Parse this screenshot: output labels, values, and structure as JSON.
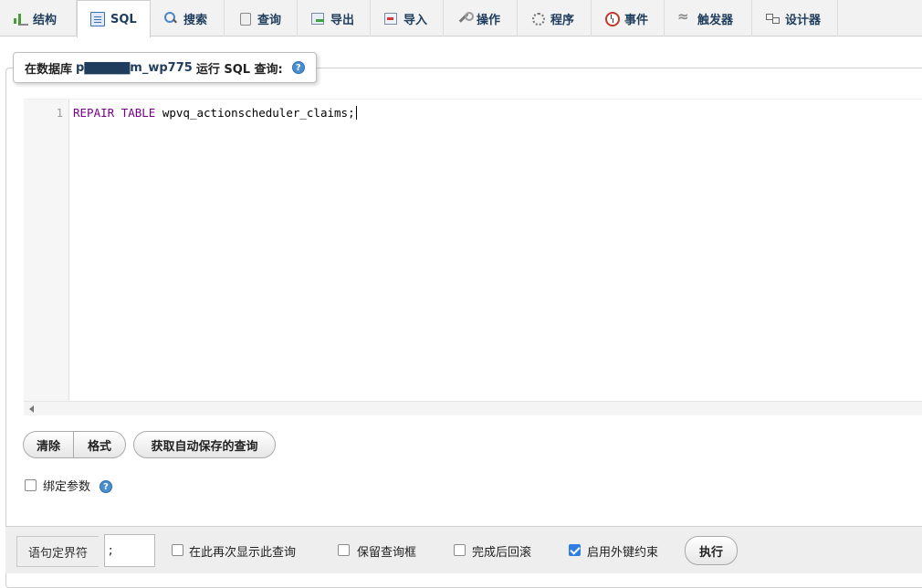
{
  "tabs": [
    {
      "label": "结构",
      "icon": "structure-icon"
    },
    {
      "label": "SQL",
      "icon": "sql-icon",
      "active": true
    },
    {
      "label": "搜索",
      "icon": "search-icon"
    },
    {
      "label": "查询",
      "icon": "query-icon"
    },
    {
      "label": "导出",
      "icon": "export-icon"
    },
    {
      "label": "导入",
      "icon": "import-icon"
    },
    {
      "label": "操作",
      "icon": "wrench-icon"
    },
    {
      "label": "程序",
      "icon": "routines-icon"
    },
    {
      "label": "事件",
      "icon": "clock-icon"
    },
    {
      "label": "触发器",
      "icon": "trigger-icon"
    },
    {
      "label": "设计器",
      "icon": "designer-icon"
    }
  ],
  "query_panel": {
    "legend_prefix": "在数据库",
    "db_name": "p▇▇▇▇▇m_wp775",
    "legend_suffix": "运行 SQL 查询:",
    "help_icon": "help-icon"
  },
  "editor": {
    "line_number": "1",
    "code_keyword_1": "REPAIR",
    "code_keyword_2": "TABLE",
    "code_identifier": "wpvq_actionscheduler_claims",
    "code_terminator": ";"
  },
  "buttons": {
    "clear": "清除",
    "format": "格式",
    "get_autosaved": "获取自动保存的查询"
  },
  "bind_params": {
    "label": "绑定参数",
    "checked": false
  },
  "footer": {
    "delimiter_label": "语句定界符",
    "delimiter_value": ";",
    "options": [
      {
        "label": "在此再次显示此查询",
        "checked": false
      },
      {
        "label": "保留查询框",
        "checked": false
      },
      {
        "label": "完成后回滚",
        "checked": false
      },
      {
        "label": "启用外键约束",
        "checked": true
      }
    ],
    "execute": "执行"
  },
  "colors": {
    "accent": "#2f7de1",
    "keyword": "#770088",
    "tab_text": "#1f3d5c"
  }
}
